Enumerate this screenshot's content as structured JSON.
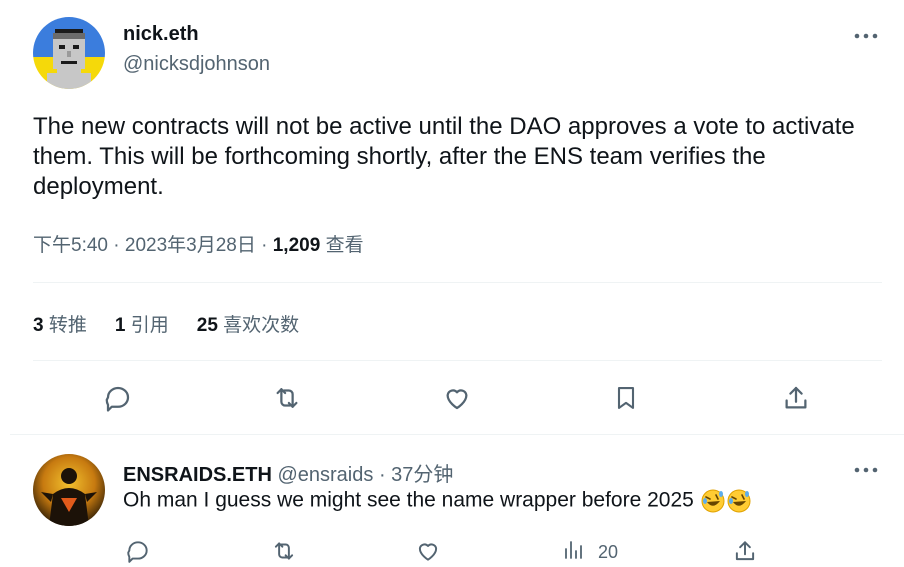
{
  "tweet": {
    "author_name": "nick.eth",
    "author_handle": "@nicksdjohnson",
    "text": "The new contracts will not be active until the DAO approves a vote to activate them. This will be forthcoming shortly, after the ENS team verifies the deployment.",
    "time": "下午5:40",
    "date": "2023年3月28日",
    "separator": "·",
    "views_count": "1,209",
    "views_label": "查看",
    "stats": {
      "retweets_count": "3",
      "retweets_label": "转推",
      "quotes_count": "1",
      "quotes_label": "引用",
      "likes_count": "25",
      "likes_label": "喜欢次数"
    }
  },
  "reply": {
    "author_name": "ENSRAIDS.ETH",
    "author_handle": "@ensraids",
    "separator": "·",
    "time_ago": "37分钟",
    "text": "Oh man I guess we might see the name wrapper before 2025",
    "emoji": "rolling-on-floor-laughing",
    "views_count": "20"
  },
  "colors": {
    "text_primary": "#0f1419",
    "text_secondary": "#536471",
    "divider": "#eff3f4",
    "avatar_bg_top": "#3b7ddd",
    "avatar_bg_bottom": "#f5d90a"
  },
  "icons": [
    "more-icon",
    "reply-icon",
    "retweet-icon",
    "like-icon",
    "bookmark-icon",
    "share-icon",
    "views-icon"
  ]
}
